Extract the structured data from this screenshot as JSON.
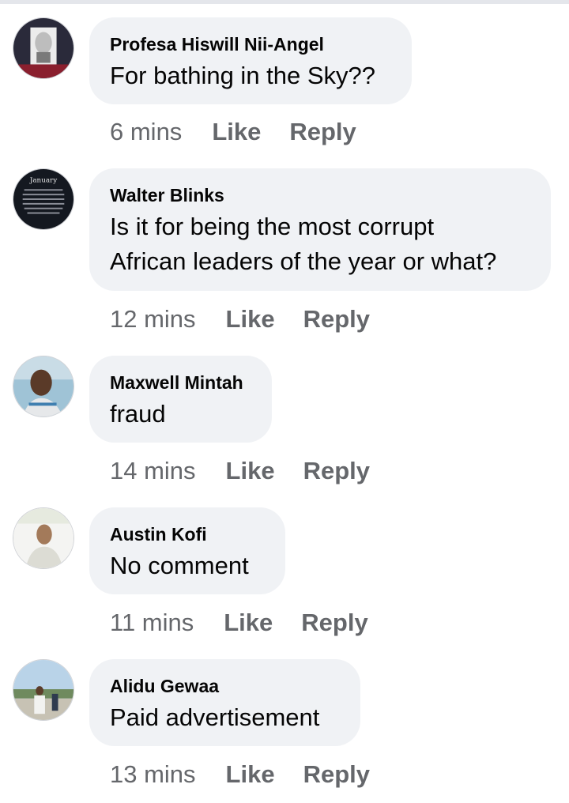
{
  "comments": [
    {
      "author": "Profesa Hiswill Nii-Angel",
      "text": [
        "For bathing in the Sky??"
      ],
      "time": "6 mins",
      "avatar": "portrait-sketch-avatar"
    },
    {
      "author": "Walter Blinks",
      "text": [
        "Is it for being the most corrupt",
        "African leaders of the year or what?"
      ],
      "time": "12 mins",
      "avatar": "january-text-avatar",
      "avatar_label": "January"
    },
    {
      "author": "Maxwell Mintah",
      "text": [
        "fraud"
      ],
      "time": "14 mins",
      "avatar": "selfie-photo-avatar"
    },
    {
      "author": "Austin Kofi",
      "text": [
        "No comment"
      ],
      "time": "11 mins",
      "avatar": "person-photo-avatar"
    },
    {
      "author": "Alidu Gewaa",
      "text": [
        "Paid advertisement"
      ],
      "time": "13 mins",
      "avatar": "outdoor-photo-avatar"
    }
  ],
  "actions": {
    "like_label": "Like",
    "reply_label": "Reply"
  },
  "colors": {
    "bubble": "#f0f2f5",
    "meta_text": "#65676b",
    "text": "#050505"
  }
}
